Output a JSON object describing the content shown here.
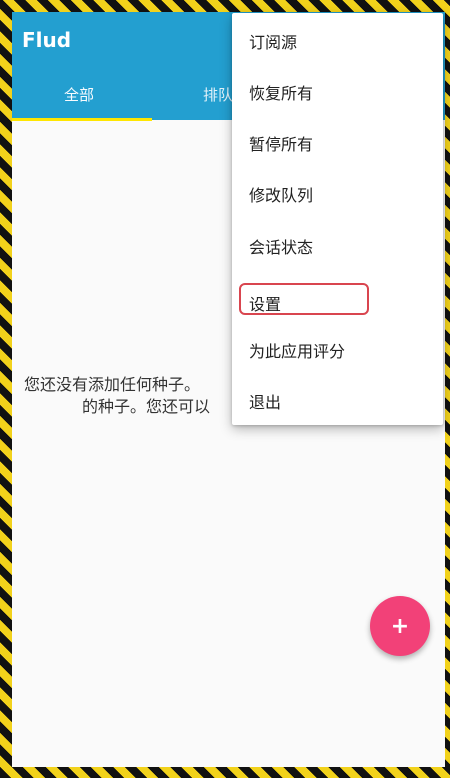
{
  "app": {
    "title": "Flud"
  },
  "tabs": {
    "all": "全部",
    "queued_partial": "排队"
  },
  "empty_state": {
    "line1": "您还没有添加任何种子。",
    "line2": "的种子。您还可以"
  },
  "fab": {
    "icon": "plus-icon",
    "symbol": "+"
  },
  "menu": {
    "items": [
      {
        "label": "订阅源"
      },
      {
        "label": "恢复所有"
      },
      {
        "label": "暂停所有"
      },
      {
        "label": "修改队列"
      },
      {
        "label": "会话状态"
      },
      {
        "label": "设置",
        "highlighted": true
      },
      {
        "label": "为此应用评分"
      },
      {
        "label": "退出"
      }
    ]
  },
  "colors": {
    "appbar": "#239fd0",
    "fab": "#f24178",
    "tab_indicator": "#ffe600",
    "highlight_box": "#d9454f"
  }
}
